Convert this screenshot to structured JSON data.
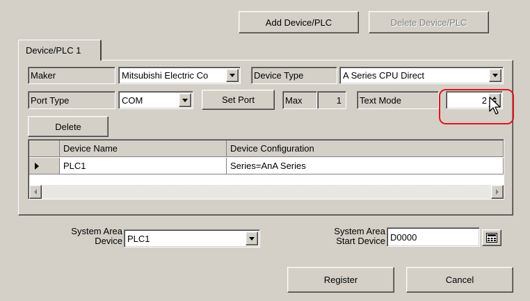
{
  "toolbar": {
    "add_label": "Add Device/PLC",
    "delete_label": "Delete Device/PLC"
  },
  "tab": {
    "label": "Device/PLC 1"
  },
  "maker": {
    "label": "Maker",
    "value": "Mitsubishi Electric Co"
  },
  "device_type": {
    "label": "Device Type",
    "value": "A Series CPU Direct"
  },
  "port_type": {
    "label": "Port Type",
    "value": "COM"
  },
  "set_port_label": "Set Port",
  "max": {
    "label": "Max",
    "value": "1"
  },
  "text_mode": {
    "label": "Text Mode",
    "value": "2"
  },
  "delete_label": "Delete",
  "table": {
    "headers": [
      "Device Name",
      "Device Configuration"
    ],
    "rows": [
      {
        "name": "PLC1",
        "config": "Series=AnA Series"
      }
    ]
  },
  "system_area_device": {
    "label_line1": "System Area",
    "label_line2": "Device",
    "value": "PLC1"
  },
  "system_area_start": {
    "label_line1": "System Area",
    "label_line2": "Start Device",
    "value": "D0000"
  },
  "footer": {
    "register_label": "Register",
    "cancel_label": "Cancel"
  },
  "colors": {
    "highlight": "#e0161b",
    "face": "#d4d0c8"
  }
}
